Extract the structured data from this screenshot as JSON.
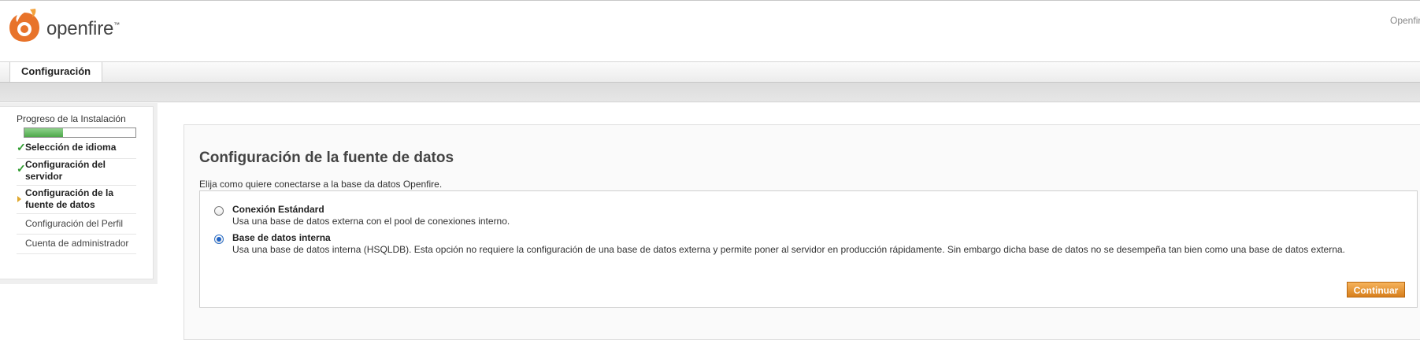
{
  "header": {
    "brand": "openfire",
    "brand_tm": "™",
    "right_text": "Openfire"
  },
  "tabs": [
    {
      "label": "Configuración"
    }
  ],
  "sidebar": {
    "progress_label": "Progreso de la Instalación",
    "progress_fraction": 0.35,
    "steps": [
      {
        "label": "Selección de idioma",
        "state": "done"
      },
      {
        "label": "Configuración del servidor",
        "state": "done"
      },
      {
        "label": "Configuración de la fuente de datos",
        "state": "current"
      },
      {
        "label": "Configuración del Perfil",
        "state": "todo"
      },
      {
        "label": "Cuenta de administrador",
        "state": "todo"
      }
    ]
  },
  "main": {
    "title": "Configuración de la fuente de datos",
    "intro": "Elija como quiere conectarse a la base da datos Openfire.",
    "options": [
      {
        "title": "Conexión Estándard",
        "desc": "Usa una base de datos externa con el pool de conexiones interno.",
        "selected": false
      },
      {
        "title": "Base de datos interna",
        "desc": "Usa una base de datos interna (HSQLDB). Esta opción no requiere la configuración de una base de datos externa y permite poner al servidor en producción rápidamente. Sin embargo dicha base de datos no se desempeña tan bien como una base de datos externa.",
        "selected": true
      }
    ],
    "continue_label": "Continuar"
  },
  "colors": {
    "accent_orange": "#e0912a",
    "progress_green": "#5cb85c",
    "check_green": "#2e9b2e"
  }
}
